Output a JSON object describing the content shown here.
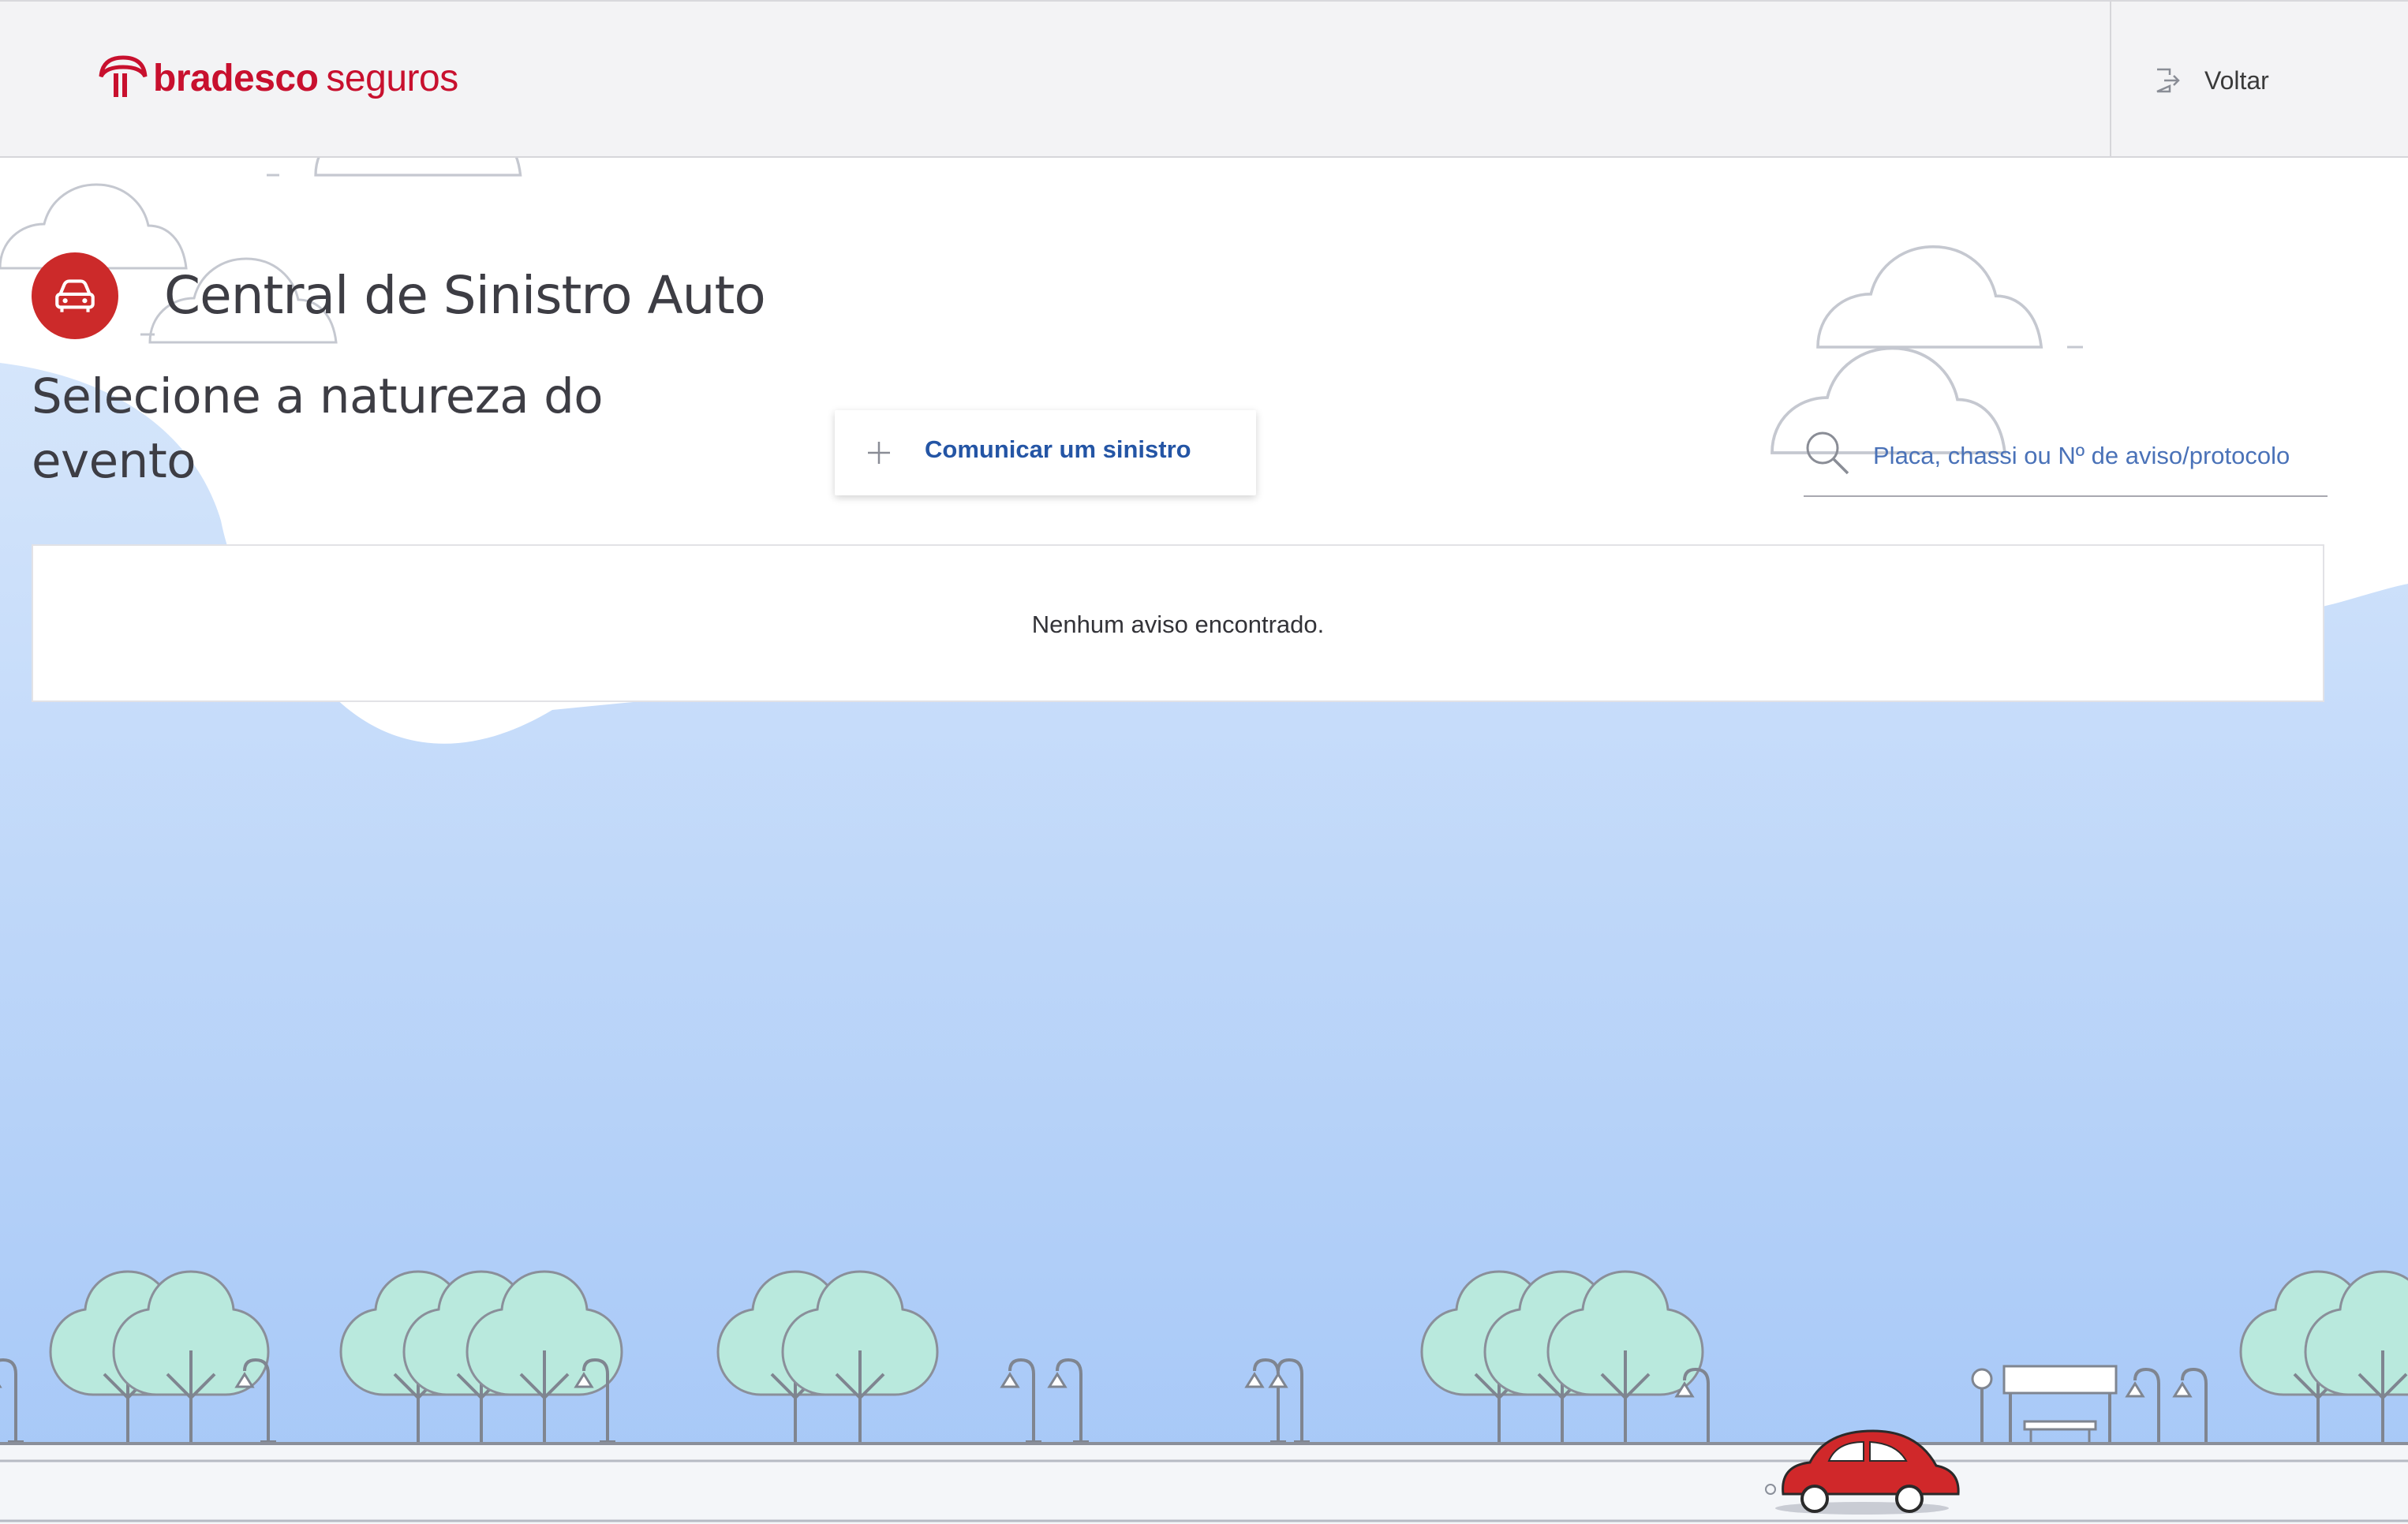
{
  "header": {
    "brand_bold": "bradesco",
    "brand_light": "seguros",
    "back_label": "Voltar"
  },
  "page": {
    "title": "Central de Sinistro Auto",
    "subtitle": "Selecione a natureza do evento"
  },
  "actions": {
    "report_label": "Comunicar um sinistro"
  },
  "search": {
    "placeholder": "Placa, chassi ou Nº de aviso/protocolo",
    "value": ""
  },
  "results": {
    "empty_message": "Nenhum aviso encontrado."
  },
  "icons": {
    "logo": "bradesco-tree-logo",
    "back": "exit-door-icon",
    "page": "car-front-icon",
    "add": "plus-icon",
    "search": "magnifier-icon"
  },
  "colors": {
    "brand_red": "#c8102e",
    "link_blue": "#2455a5",
    "sky_top": "#d8e8fb",
    "sky_bottom": "#a6c8f7",
    "tree_fill": "#b8e8dc",
    "car_red": "#d0282a"
  }
}
